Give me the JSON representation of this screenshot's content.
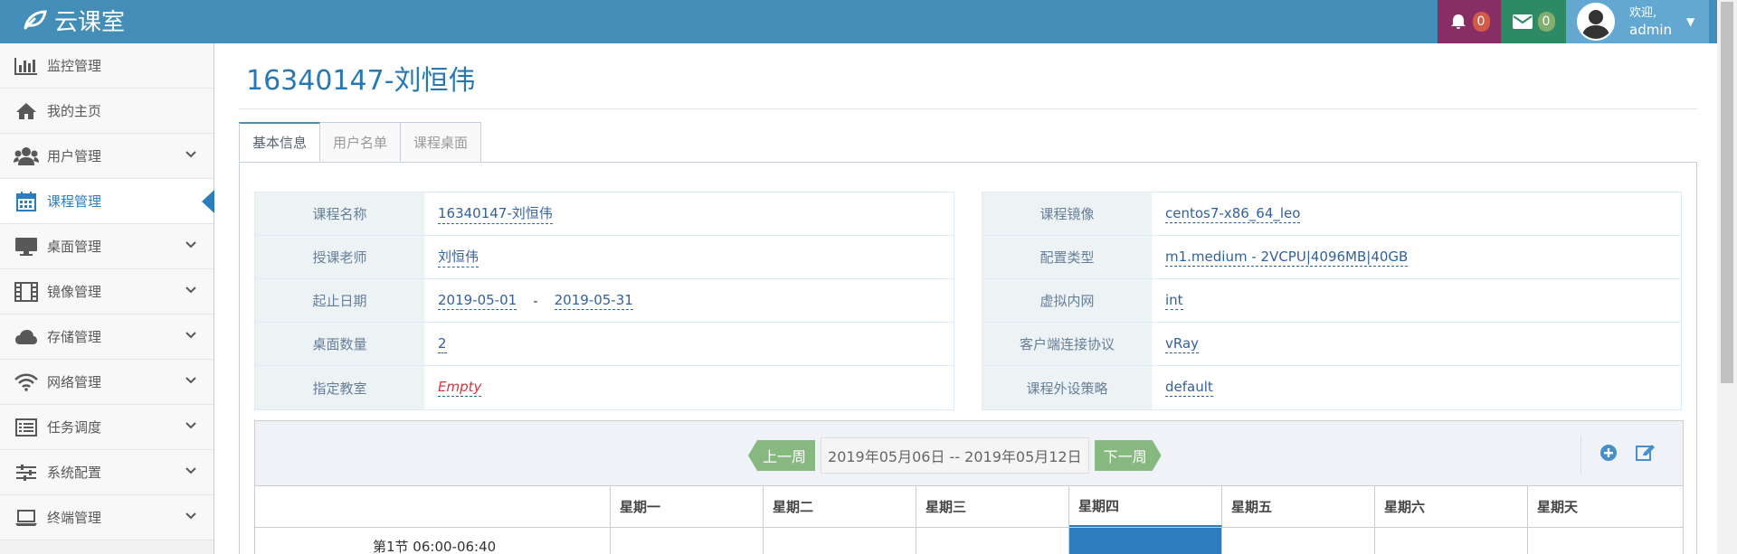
{
  "navbar": {
    "brand": "云课室",
    "notifications_count": "0",
    "messages_count": "0",
    "user_greeting": "欢迎,",
    "user_name": "admin",
    "colors": {
      "navbar": "#438eb9",
      "bell_bg": "#892e65",
      "mail_bg": "#2e8965",
      "user_bg": "#62a8d1"
    }
  },
  "sidebar": {
    "items": [
      {
        "label": "监控管理",
        "icon": "bar-chart-icon",
        "has_arrow": false
      },
      {
        "label": "我的主页",
        "icon": "home-icon",
        "has_arrow": false
      },
      {
        "label": "用户管理",
        "icon": "users-icon",
        "has_arrow": true
      },
      {
        "label": "课程管理",
        "icon": "calendar-icon",
        "has_arrow": false,
        "active": true
      },
      {
        "label": "桌面管理",
        "icon": "desktop-icon",
        "has_arrow": true
      },
      {
        "label": "镜像管理",
        "icon": "film-icon",
        "has_arrow": true
      },
      {
        "label": "存储管理",
        "icon": "cloud-icon",
        "has_arrow": true
      },
      {
        "label": "网络管理",
        "icon": "wifi-icon",
        "has_arrow": true
      },
      {
        "label": "任务调度",
        "icon": "list-icon",
        "has_arrow": true
      },
      {
        "label": "系统配置",
        "icon": "sliders-icon",
        "has_arrow": true
      },
      {
        "label": "终端管理",
        "icon": "laptop-icon",
        "has_arrow": true
      }
    ]
  },
  "main": {
    "page_title": "16340147-刘恒伟",
    "tabs": [
      "基本信息",
      "用户名单",
      "课程桌面"
    ],
    "info_left": [
      {
        "name": "课程名称",
        "value": "16340147-刘恒伟"
      },
      {
        "name": "授课老师",
        "value": "刘恒伟"
      },
      {
        "name": "起止日期",
        "start": "2019-05-01",
        "sep": "-",
        "end": "2019-05-31"
      },
      {
        "name": "桌面数量",
        "value": "2"
      },
      {
        "name": "指定教室",
        "value": "Empty"
      }
    ],
    "info_right": [
      {
        "name": "课程镜像",
        "value": "centos7-x86_64_leo"
      },
      {
        "name": "配置类型",
        "value": "m1.medium - 2VCPU|4096MB|40GB"
      },
      {
        "name": "虚拟内网",
        "value": "int"
      },
      {
        "name": "客户端连接协议",
        "value": "vRay"
      },
      {
        "name": "课程外设策略",
        "value": "default"
      }
    ],
    "calendar": {
      "prev_week": "上一周",
      "next_week": "下一周",
      "range": "2019年05月06日 -- 2019年05月12日",
      "days": [
        "星期一",
        "星期二",
        "星期三",
        "星期四",
        "星期五",
        "星期六",
        "星期天"
      ],
      "first_slot": "第1节 06:00-06:40"
    }
  }
}
